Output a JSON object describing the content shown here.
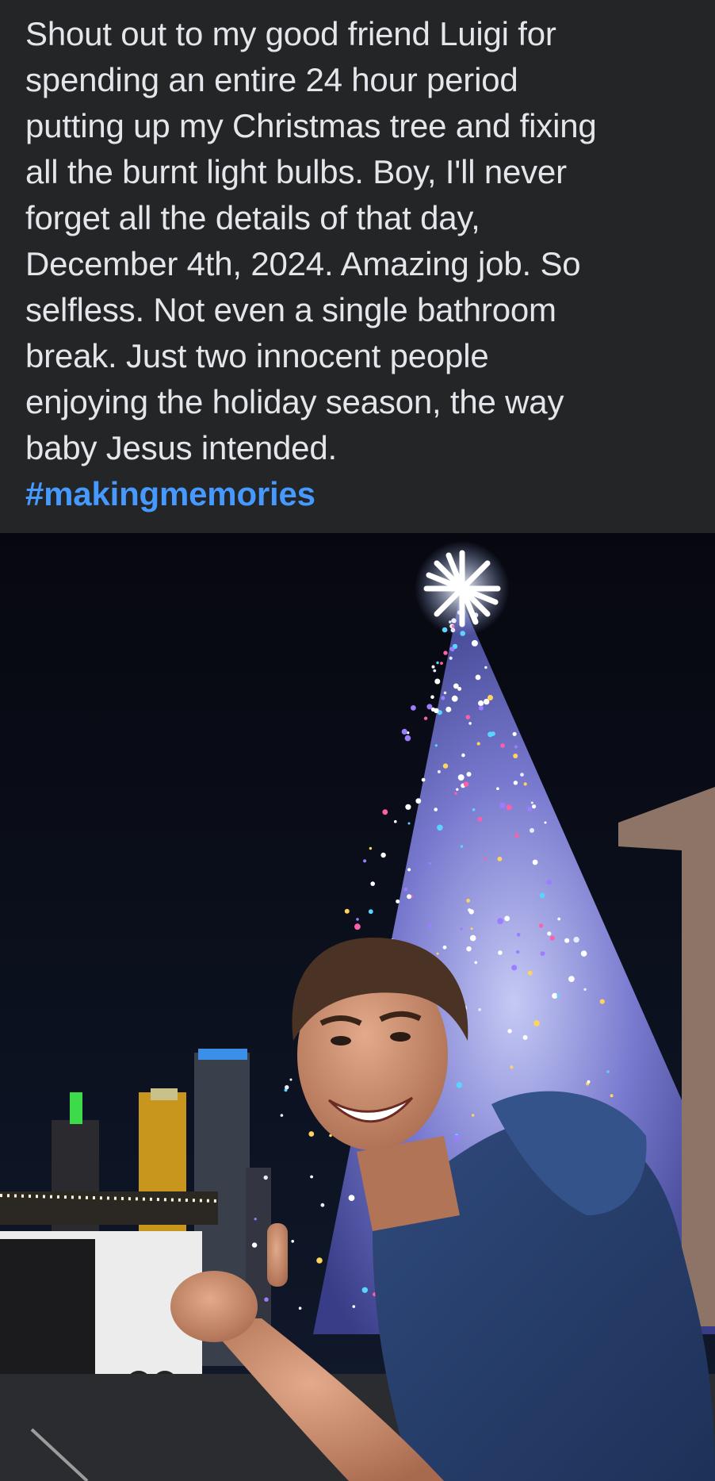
{
  "post": {
    "lines": [
      "Shout out to my good friend Luigi for",
      "spending an entire 24 hour period",
      "putting up my Christmas tree and fixing",
      "all the burnt light bulbs. Boy, I'll never",
      "forget all the details of that day,",
      "December 4th, 2024. Amazing job. So",
      "selfless. Not even a single bathroom",
      "break. Just two innocent people",
      "enjoying the holiday season, the way",
      "baby Jesus intended."
    ],
    "hashtag": "#makingmemories"
  },
  "photo": {
    "subject": "man-smiling-thumbs-up-in-front-of-lit-christmas-tree-at-night",
    "colors": {
      "sky": "#0a0c16",
      "background": "#242526",
      "text": "#e4e6eb",
      "hashtag": "#4599ff"
    }
  }
}
